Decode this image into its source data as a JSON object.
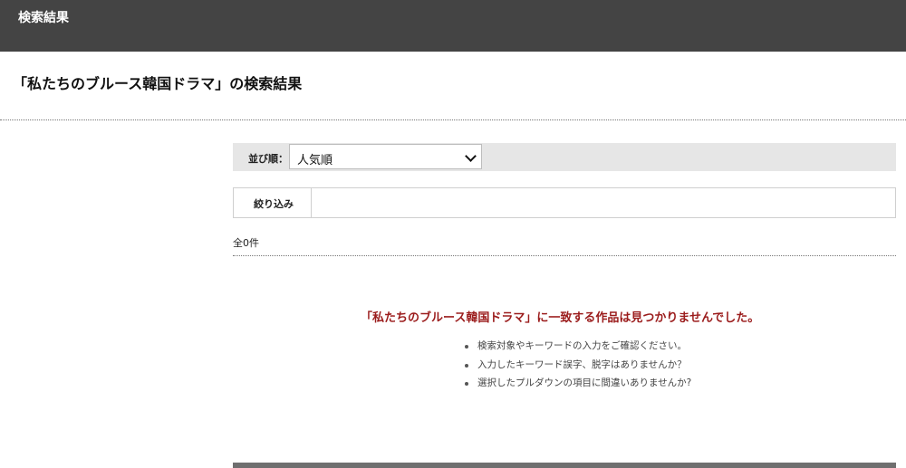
{
  "header": {
    "title": "検索結果"
  },
  "page": {
    "title": "「私たちのブルース韓国ドラマ」の検索結果"
  },
  "sort": {
    "label": "並び順：",
    "selected": "人気順"
  },
  "filter": {
    "label": "絞り込み"
  },
  "results": {
    "count": "全0件",
    "message": "「私たちのブルース韓国ドラマ」に一致する作品は見つかりませんでした。",
    "hints": [
      "検索対象やキーワードの入力をご確認ください。",
      "入力したキーワード誤字、脱字はありませんか？",
      "選択したプルダウンの項目に間違いありませんか?"
    ]
  },
  "colors": {
    "header_bg": "#444444",
    "accent_red": "#9b1c1c",
    "sort_bar_bg": "#e6e6e6"
  }
}
